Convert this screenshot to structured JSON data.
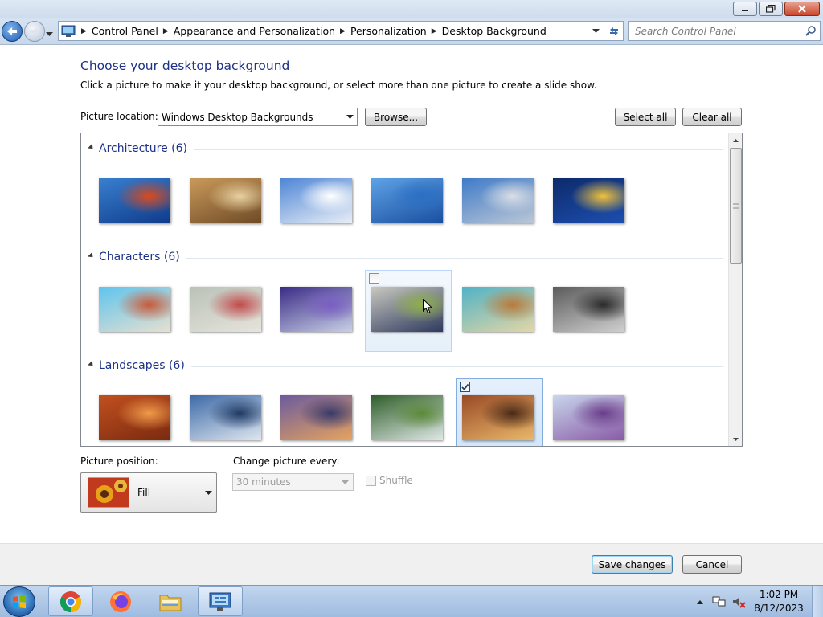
{
  "window": {
    "minimize_icon": "minimize-icon",
    "maximize_icon": "restore-icon",
    "close_icon": "close-icon"
  },
  "navigation": {
    "breadcrumbs": [
      "Control Panel",
      "Appearance and Personalization",
      "Personalization",
      "Desktop Background"
    ],
    "search_placeholder": "Search Control Panel"
  },
  "header": {
    "title": "Choose your desktop background",
    "description": "Click a picture to make it your desktop background, or select more than one picture to create a slide show."
  },
  "picture_location": {
    "label": "Picture location:",
    "value": "Windows Desktop Backgrounds",
    "browse_label": "Browse...",
    "select_all_label": "Select all",
    "clear_all_label": "Clear all"
  },
  "groups": [
    {
      "title": "Architecture (6)",
      "thumbnails": [
        {
          "name": "thumb-architecture-1",
          "colors": [
            "#3a7fcf",
            "#0e3b8a",
            "#d94a1e"
          ]
        },
        {
          "name": "thumb-architecture-2",
          "colors": [
            "#c99a5a",
            "#6e4a26",
            "#e8d0a0"
          ]
        },
        {
          "name": "thumb-architecture-3",
          "colors": [
            "#4f86d6",
            "#e9eef6",
            "#ffffff"
          ]
        },
        {
          "name": "thumb-architecture-4",
          "colors": [
            "#5ea2e6",
            "#1a4fa0",
            "#2b6fc4"
          ]
        },
        {
          "name": "thumb-architecture-5",
          "colors": [
            "#3f7bc8",
            "#bcc7d6",
            "#d9dee6"
          ]
        },
        {
          "name": "thumb-architecture-6",
          "colors": [
            "#0d2a6b",
            "#1d4fb0",
            "#f1c23a"
          ]
        }
      ]
    },
    {
      "title": "Characters (6)",
      "thumbnails": [
        {
          "name": "thumb-characters-1",
          "colors": [
            "#5ec4ee",
            "#e6e0cf",
            "#c85a3a"
          ]
        },
        {
          "name": "thumb-characters-2",
          "colors": [
            "#b9c2b8",
            "#e6e4dc",
            "#c24a4a"
          ]
        },
        {
          "name": "thumb-characters-3",
          "colors": [
            "#3a2b86",
            "#c8d0e6",
            "#7a5ec4"
          ]
        },
        {
          "name": "thumb-characters-4",
          "colors": [
            "#c9c9c0",
            "#2f3a5e",
            "#8fb04a"
          ]
        },
        {
          "name": "thumb-characters-5",
          "colors": [
            "#4fb2c6",
            "#e3d6a6",
            "#b97a3a"
          ]
        },
        {
          "name": "thumb-characters-6",
          "colors": [
            "#5b5b5b",
            "#cfcfcf",
            "#2a2a2a"
          ]
        }
      ]
    },
    {
      "title": "Landscapes (6)",
      "thumbnails": [
        {
          "name": "thumb-landscapes-1",
          "colors": [
            "#c2501f",
            "#7a2a10",
            "#f09a4a"
          ]
        },
        {
          "name": "thumb-landscapes-2",
          "colors": [
            "#3d6aa8",
            "#dfe6ef",
            "#1f3a63"
          ]
        },
        {
          "name": "thumb-landscapes-3",
          "colors": [
            "#6b5b9e",
            "#e6a35e",
            "#3a3a6a"
          ]
        },
        {
          "name": "thumb-landscapes-4",
          "colors": [
            "#2f5e2a",
            "#dfe8e6",
            "#5c8a3a"
          ]
        },
        {
          "name": "thumb-landscapes-5",
          "colors": [
            "#9a4a26",
            "#e8b86a",
            "#4a2a18"
          ]
        },
        {
          "name": "thumb-landscapes-6",
          "colors": [
            "#c8d6ec",
            "#8a5aa6",
            "#6a3e8a"
          ]
        }
      ]
    }
  ],
  "cell_states": {
    "characters_4": "hover-unchecked",
    "landscapes_5": "selected-checked"
  },
  "picture_position": {
    "label": "Picture position:",
    "value": "Fill"
  },
  "slideshow": {
    "label": "Change picture every:",
    "value": "30 minutes",
    "shuffle_label": "Shuffle",
    "shuffle_checked": false
  },
  "footer": {
    "save_label": "Save changes",
    "cancel_label": "Cancel"
  },
  "taskbar": {
    "apps": [
      "chrome-icon",
      "firefox-icon",
      "folder-icon",
      "control-panel-icon"
    ],
    "clock_time": "1:02 PM",
    "clock_date": "8/12/2023"
  },
  "colors": {
    "title_blue": "#1e3287",
    "selection_border": "#84acdd"
  }
}
